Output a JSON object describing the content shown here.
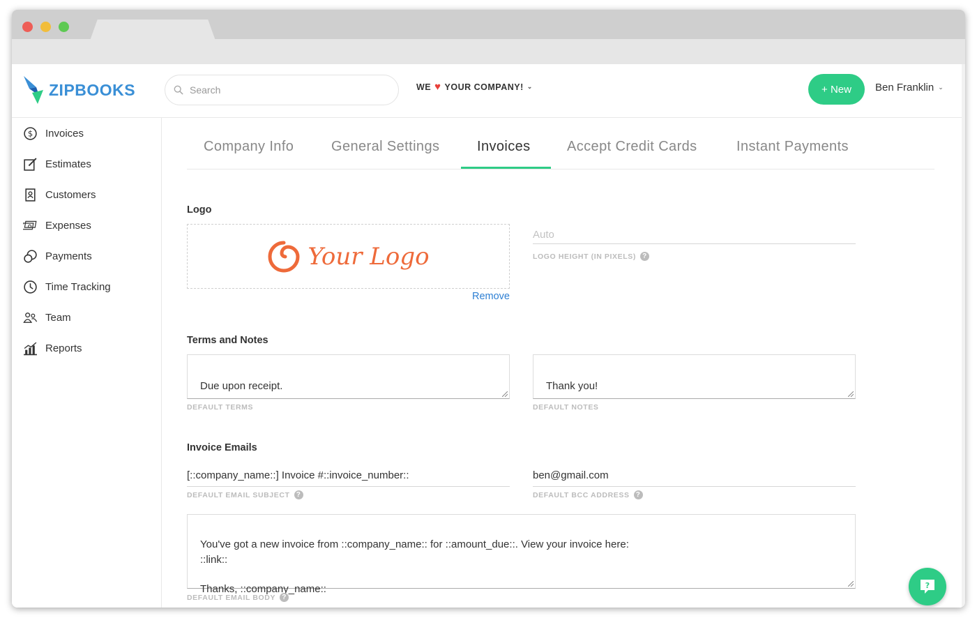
{
  "app": {
    "name": "ZIPBOOKS"
  },
  "search": {
    "placeholder": "Search"
  },
  "company_menu": {
    "prefix": "WE",
    "suffix": "YOUR COMPANY!"
  },
  "new_button": {
    "label": "+ New"
  },
  "user_menu": {
    "name": "Ben Franklin"
  },
  "sidebar": {
    "items": [
      {
        "label": "Invoices",
        "icon": "dollar-circle-icon"
      },
      {
        "label": "Estimates",
        "icon": "edit-icon"
      },
      {
        "label": "Customers",
        "icon": "contact-book-icon"
      },
      {
        "label": "Expenses",
        "icon": "cash-icon"
      },
      {
        "label": "Payments",
        "icon": "coins-icon"
      },
      {
        "label": "Time Tracking",
        "icon": "clock-icon"
      },
      {
        "label": "Team",
        "icon": "team-icon"
      },
      {
        "label": "Reports",
        "icon": "bar-chart-icon"
      }
    ]
  },
  "settings_tabs": [
    {
      "label": "Company Info"
    },
    {
      "label": "General Settings"
    },
    {
      "label": "Invoices",
      "active": true
    },
    {
      "label": "Accept Credit Cards"
    },
    {
      "label": "Instant Payments"
    }
  ],
  "logo_section": {
    "title": "Logo",
    "logo_text": "Your Logo",
    "remove_label": "Remove",
    "height_placeholder": "Auto",
    "height_caption": "LOGO HEIGHT (IN PIXELS)"
  },
  "terms_section": {
    "title": "Terms and Notes",
    "terms_value": "Due upon receipt.",
    "terms_caption": "DEFAULT TERMS",
    "notes_value": "Thank you!",
    "notes_caption": "DEFAULT NOTES"
  },
  "email_section": {
    "title": "Invoice Emails",
    "subject_value": "[::company_name::] Invoice #::invoice_number::",
    "subject_caption": "DEFAULT EMAIL SUBJECT",
    "bcc_value": "ben@gmail.com",
    "bcc_caption": "DEFAULT BCC ADDRESS",
    "body_value": "You've got a new invoice from ::company_name:: for ::amount_due::.  View your invoice here:\n::link::\n\nThanks, ::company_name::",
    "body_caption": "DEFAULT EMAIL BODY"
  },
  "colors": {
    "accent": "#2ecc86",
    "brand": "#3a8fd6",
    "link": "#2d7fd3",
    "logo_orange": "#ee6a3a"
  }
}
